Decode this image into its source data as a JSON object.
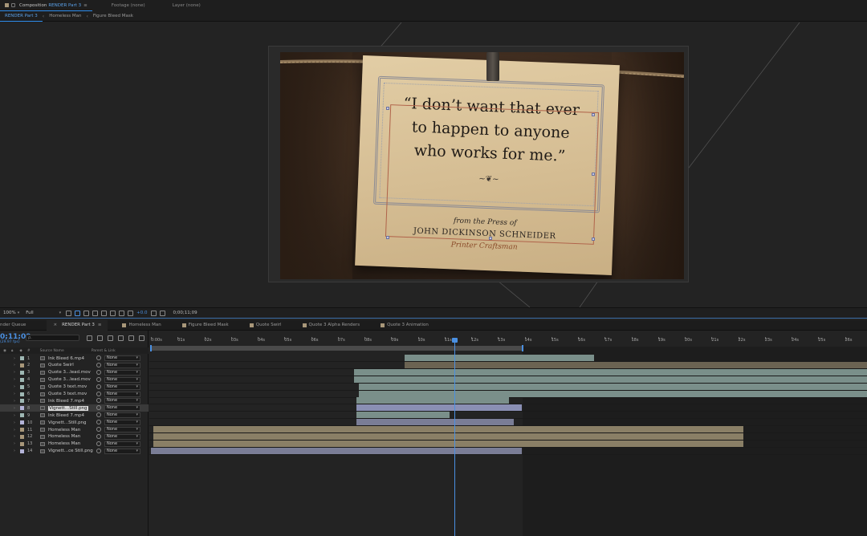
{
  "panel_tabs": {
    "composition_prefix": "Composition",
    "composition_name": "RENDER Part 3",
    "composition_menu": "≡",
    "footage": "Footage (none)",
    "layer": "Layer (none)"
  },
  "breadcrumb": [
    "RENDER Part 3",
    "Homeless Man",
    "Figure Bleed Mask"
  ],
  "viewer": {
    "quote_line1": "“I don’t want that ever",
    "quote_line2": "to happen to anyone",
    "quote_line3": "who works for me.”",
    "flourish": "~❦~",
    "press_from": "from the Press of",
    "press_name": "JOHN DICKINSON SCHNEIDER",
    "press_sub": "Printer Craftsman"
  },
  "viewer_toolbar": {
    "zoom": "100%",
    "resolution": "Full",
    "exposure": "+0.0",
    "timecode": "0;00;11;09"
  },
  "timeline_tabs": [
    {
      "label": "nder Queue"
    },
    {
      "label": "RENDER Part 3",
      "active": true,
      "close": "×",
      "menu": "≡"
    },
    {
      "label": "Homeless Man",
      "color": "#a8977a"
    },
    {
      "label": "Figure Bleed Mask",
      "color": "#a8977a"
    },
    {
      "label": "Quote Swirl",
      "color": "#a8977a"
    },
    {
      "label": "Quote 3 Alpha Renders",
      "color": "#a8977a"
    },
    {
      "label": "Quote 3 Animation",
      "color": "#a8977a"
    }
  ],
  "timeline": {
    "timecode": "0;11;09",
    "fps": "(29.97 fps)",
    "search_placeholder": "ρ.",
    "col_source": "Source Name",
    "col_parent": "Parent & Link",
    "col_num": "#",
    "ruler": [
      "0:00s",
      "01s",
      "02s",
      "03s",
      "04s",
      "05s",
      "06s",
      "07s",
      "08s",
      "09s",
      "10s",
      "11s",
      "12s",
      "13s",
      "14s",
      "15s",
      "16s",
      "17s",
      "18s",
      "19s",
      "20s",
      "21s",
      "22s",
      "23s",
      "24s",
      "25s",
      "26s"
    ],
    "layers": [
      {
        "num": "1",
        "name": "Ink Bleed 6.mp4",
        "parent": "None",
        "label": "#9fb8b4",
        "bar_color": "#7a8f8a",
        "start": 9.5,
        "end": 16.6
      },
      {
        "num": "2",
        "name": "Quote Swirl",
        "parent": "None",
        "label": "#a8977a",
        "bar_color": "#6b6352",
        "start": 9.5,
        "end": 27.0
      },
      {
        "num": "3",
        "name": "Quote 3...lead.mov",
        "parent": "None",
        "label": "#9fb8b4",
        "bar_color": "#7a8f8a",
        "start": 7.6,
        "end": 27.0
      },
      {
        "num": "4",
        "name": "Quote 3...lead.mov",
        "parent": "None",
        "label": "#9fb8b4",
        "bar_color": "#7a8f8a",
        "start": 7.6,
        "end": 27.0
      },
      {
        "num": "5",
        "name": "Quote 3 text.mov",
        "parent": "None",
        "label": "#9fb8b4",
        "bar_color": "#7a8f8a",
        "start": 7.8,
        "end": 27.0
      },
      {
        "num": "6",
        "name": "Quote 3 text.mov",
        "parent": "None",
        "label": "#9fb8b4",
        "bar_color": "#7a8f8a",
        "start": 7.8,
        "end": 27.0
      },
      {
        "num": "7",
        "name": "Ink Bleed 7.mp4",
        "parent": "None",
        "label": "#9fb8b4",
        "bar_color": "#7a8f8a",
        "start": 7.7,
        "end": 13.4
      },
      {
        "num": "8",
        "name": "Vignett...Still.png",
        "parent": "None",
        "label": "#b4b4d8",
        "bar_color": "#8a8fb4",
        "start": 7.7,
        "end": 13.9,
        "selected": true
      },
      {
        "num": "9",
        "name": "Ink Bleed 7.mp4",
        "parent": "None",
        "label": "#9fb8b4",
        "bar_color": "#7a8f8a",
        "start": 7.7,
        "end": 11.2
      },
      {
        "num": "10",
        "name": "Vignett...Still.png",
        "parent": "None",
        "label": "#b4b4d8",
        "bar_color": "#7a7d96",
        "start": 7.7,
        "end": 13.6
      },
      {
        "num": "11",
        "name": "Homeless Man",
        "parent": "None",
        "label": "#a8977a",
        "bar_color": "#8a7f66",
        "start": 0.1,
        "end": 22.2
      },
      {
        "num": "12",
        "name": "Homeless Man",
        "parent": "None",
        "label": "#a8977a",
        "bar_color": "#8a7f66",
        "start": 0.1,
        "end": 22.2
      },
      {
        "num": "13",
        "name": "Homeless Man",
        "parent": "None",
        "label": "#a8977a",
        "bar_color": "#8a7f66",
        "start": 0.1,
        "end": 22.2
      },
      {
        "num": "14",
        "name": "Vignett...ce Still.png",
        "parent": "None",
        "label": "#b4b4d8",
        "bar_color": "#7a7d96",
        "start": 0.0,
        "end": 13.9
      }
    ]
  }
}
